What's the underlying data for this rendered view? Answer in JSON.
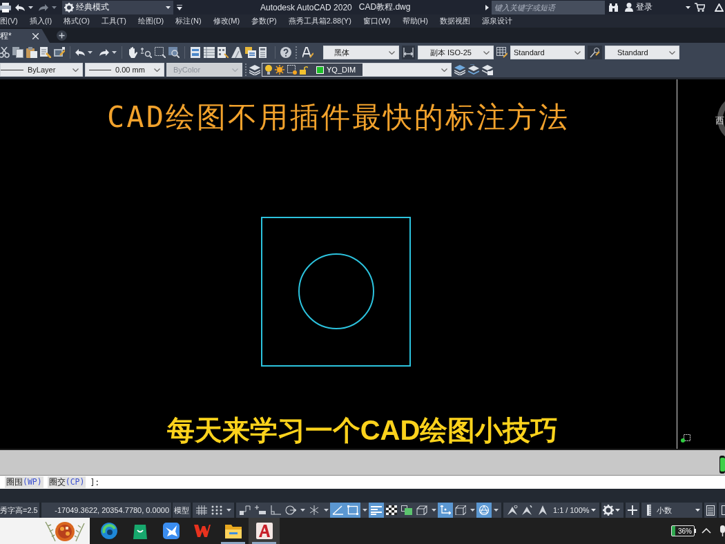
{
  "title_bar": {
    "workspace": "经典模式",
    "app_title": "Autodesk AutoCAD 2020",
    "file_name": "CAD教程.dwg",
    "search": {
      "placeholder": "键入关键字或短语"
    },
    "sign_in": "登录"
  },
  "menu_bar": [
    "图(V)",
    "插入(I)",
    "格式(O)",
    "工具(T)",
    "绘图(D)",
    "标注(N)",
    "修改(M)",
    "参数(P)",
    "燕秀工具箱2.88(Y)",
    "窗口(W)",
    "帮助(H)",
    "数据视图",
    "源泉设计"
  ],
  "file_tabs": [
    {
      "label": "程*",
      "selected": true
    }
  ],
  "styles_toolbar": {
    "text_font": "黑体",
    "dimension_style": "副本 ISO-25",
    "table_style": "Standard",
    "multileader_style": "Standard"
  },
  "properties_toolbar": {
    "linetype": "ByLayer",
    "lineweight": "0.00 mm",
    "plot_style": {
      "value": "ByColor",
      "disabled": true
    },
    "layer": {
      "name": "YQ_DIM"
    }
  },
  "drawing": {
    "title": "CAD绘图不用插件最快的标注方法",
    "subtitle": "每天来学习一个CAD绘图小技巧",
    "viewcube_label": "西"
  },
  "command_line": {
    "options": [
      {
        "label": "圈围",
        "key": "(WP)"
      },
      {
        "label": "圈交",
        "key": "(CP)"
      }
    ],
    "end": "]:"
  },
  "status_bar": {
    "text_height": "秀字高=2.5",
    "coordinates": "-17049.3622, 20354.7780, 0.0000",
    "space": "模型",
    "toggle_groups": [
      {
        "toggles": [
          {
            "kind": "grid",
            "on": false,
            "dropdown": false
          },
          {
            "kind": "snap",
            "on": false,
            "dropdown": true
          }
        ]
      },
      {
        "toggles": [
          {
            "kind": "infer",
            "on": false,
            "dropdown": false
          },
          {
            "kind": "dyninput",
            "on": false,
            "dropdown": false
          },
          {
            "kind": "ortho",
            "on": false,
            "dropdown": false
          },
          {
            "kind": "polar",
            "on": false,
            "dropdown": true
          },
          {
            "kind": "isodraft",
            "on": false,
            "dropdown": true
          },
          {
            "kind": "otrack",
            "on": true,
            "dropdown": false
          },
          {
            "kind": "osnap",
            "on": true,
            "dropdown": true
          },
          {
            "kind": "lineweight",
            "on": true,
            "dropdown": false
          },
          {
            "kind": "transparency",
            "on": false,
            "dropdown": false
          },
          {
            "kind": "selcycle",
            "on": false,
            "dropdown": false
          },
          {
            "kind": "osnap3d",
            "on": false,
            "dropdown": true
          },
          {
            "kind": "ducs",
            "on": true,
            "dropdown": false
          },
          {
            "kind": "selfilter",
            "on": false,
            "dropdown": true
          },
          {
            "kind": "gizmo",
            "on": true,
            "dropdown": true
          }
        ]
      }
    ],
    "annotation": {
      "toggles": [
        {
          "kind": "annovis",
          "on": false,
          "dropdown": false
        },
        {
          "kind": "autoscale",
          "on": false,
          "dropdown": false
        },
        {
          "kind": "annoscale",
          "on": false,
          "dropdown": false
        }
      ],
      "scale": "1:1 / 100%"
    },
    "units": "小数"
  },
  "taskbar": {
    "apps": [
      {
        "kind": "browser",
        "selected": false,
        "running": false
      },
      {
        "kind": "shop",
        "selected": false,
        "running": false
      },
      {
        "kind": "bird",
        "selected": false,
        "running": false
      },
      {
        "kind": "office",
        "selected": false,
        "running": false
      },
      {
        "kind": "folder",
        "selected": false,
        "running": true
      },
      {
        "kind": "cad",
        "selected": true,
        "running": true
      }
    ],
    "battery": "36%"
  }
}
